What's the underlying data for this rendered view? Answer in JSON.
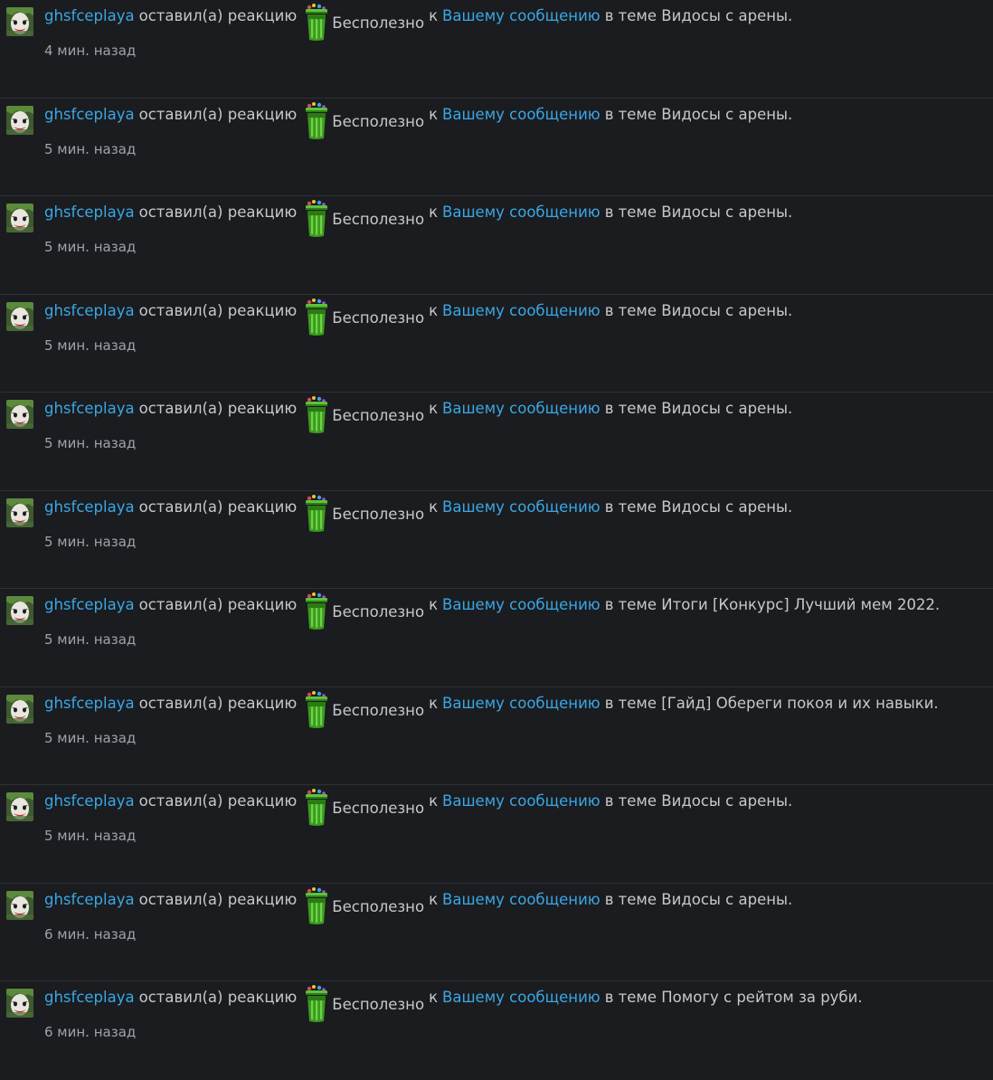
{
  "alerts": [
    {
      "user": "ghsfceplaya",
      "action": "оставил(а) реакцию",
      "reaction": "Бесполезно",
      "to": "к",
      "link": "Вашему сообщению",
      "in_thread": "в теме Видосы с арены.",
      "time": "4 мин. назад"
    },
    {
      "user": "ghsfceplaya",
      "action": "оставил(а) реакцию",
      "reaction": "Бесполезно",
      "to": "к",
      "link": "Вашему сообщению",
      "in_thread": "в теме Видосы с арены.",
      "time": "5 мин. назад"
    },
    {
      "user": "ghsfceplaya",
      "action": "оставил(а) реакцию",
      "reaction": "Бесполезно",
      "to": "к",
      "link": "Вашему сообщению",
      "in_thread": "в теме Видосы с арены.",
      "time": "5 мин. назад"
    },
    {
      "user": "ghsfceplaya",
      "action": "оставил(а) реакцию",
      "reaction": "Бесполезно",
      "to": "к",
      "link": "Вашему сообщению",
      "in_thread": "в теме Видосы с арены.",
      "time": "5 мин. назад"
    },
    {
      "user": "ghsfceplaya",
      "action": "оставил(а) реакцию",
      "reaction": "Бесполезно",
      "to": "к",
      "link": "Вашему сообщению",
      "in_thread": "в теме Видосы с арены.",
      "time": "5 мин. назад"
    },
    {
      "user": "ghsfceplaya",
      "action": "оставил(а) реакцию",
      "reaction": "Бесполезно",
      "to": "к",
      "link": "Вашему сообщению",
      "in_thread": "в теме Видосы с арены.",
      "time": "5 мин. назад"
    },
    {
      "user": "ghsfceplaya",
      "action": "оставил(а) реакцию",
      "reaction": "Бесполезно",
      "to": "к",
      "link": "Вашему сообщению",
      "in_thread": "в теме Итоги [Конкурс] Лучший мем 2022.",
      "time": "5 мин. назад"
    },
    {
      "user": "ghsfceplaya",
      "action": "оставил(а) реакцию",
      "reaction": "Бесполезно",
      "to": "к",
      "link": "Вашему сообщению",
      "in_thread": "в теме [Гайд] Обереги покоя и их навыки.",
      "time": "5 мин. назад"
    },
    {
      "user": "ghsfceplaya",
      "action": "оставил(а) реакцию",
      "reaction": "Бесполезно",
      "to": "к",
      "link": "Вашему сообщению",
      "in_thread": "в теме Видосы с арены.",
      "time": "5 мин. назад"
    },
    {
      "user": "ghsfceplaya",
      "action": "оставил(а) реакцию",
      "reaction": "Бесполезно",
      "to": "к",
      "link": "Вашему сообщению",
      "in_thread": "в теме Видосы с арены.",
      "time": "6 мин. назад"
    },
    {
      "user": "ghsfceplaya",
      "action": "оставил(а) реакцию",
      "reaction": "Бесполезно",
      "to": "к",
      "link": "Вашему сообщению",
      "in_thread": "в теме Помогу с рейтом за руби.",
      "time": "6 мин. назад"
    }
  ],
  "icons": {
    "avatar": "joker-avatar-icon",
    "reaction": "trash-can-icon"
  },
  "colors": {
    "background": "#1b1c1f",
    "link": "#39a7e6",
    "text": "#c6c8cc",
    "muted": "#9fa2a8",
    "divider": "#2e3034",
    "reaction_green": "#3c9a1e"
  }
}
